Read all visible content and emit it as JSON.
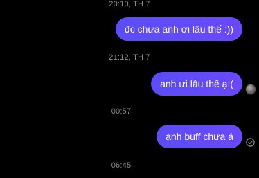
{
  "timestamps": [
    "20:10, TH 7",
    "21:12, TH 7",
    "00:57",
    "06:45"
  ],
  "messages": [
    {
      "text": "đc chưa anh ơi lâu thế :))",
      "status": "none"
    },
    {
      "text": "anh ưi lâu thế ạ:(",
      "status": "seen-avatar"
    },
    {
      "text": "anh buff chưa á",
      "status": "sent-check-icon"
    }
  ],
  "colors": {
    "background": "#000000",
    "bubble": "#6048ff",
    "timestamp_text": "#8e8e93",
    "message_text": "#ffffff"
  }
}
